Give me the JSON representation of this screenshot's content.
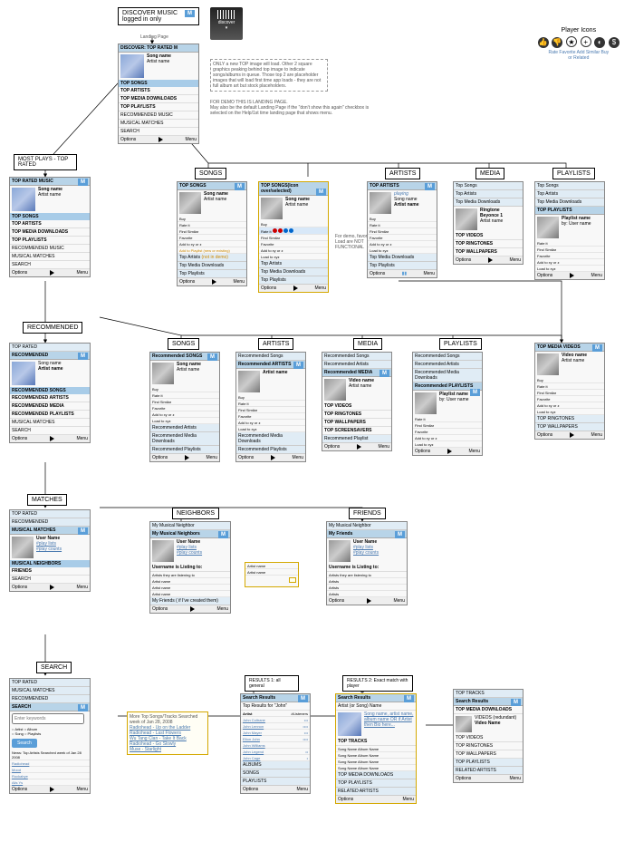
{
  "header": {
    "discover_music": "DISCOVER MUSIC",
    "logged_in": "logged in only",
    "landing_page": "Landing Page",
    "discover_btn": "discover"
  },
  "player_icons": {
    "title": "Player Icons",
    "labels": "Rate  Favorite  Add  Similar  Buy\nor Related"
  },
  "notes": {
    "top_note": "ONLY a new TOP image will load. Other 2 square graphics peaking behind top image to indicate songs/albums in queue. Those top 2 are placeholder images that will load first time app loads - they are not full album art but stock placeholders.",
    "demo_note": "FOR DEMO THIS IS LANDING PAGE.\nMay also be the default  Landing Page if the \"don't show this again\" checkbox is selected on the Help/1st time landing page that shows menu.",
    "functional": "For demo, favorite, Add, Load are NOT FUNCTIONAL",
    "not_in_demo": "(not in demo)",
    "more_searches": "More Top Songs/Tracks Searched week of Jan 28, 2008",
    "search_list": [
      "Radiohead - Up on the Ladder",
      "Radiohead - Last Flowers",
      "Wu Tang Clan - Take It Back",
      "Radiohead - Go Slowly",
      "Muse - Starlight"
    ]
  },
  "labels": {
    "most_plays": "MOST PLAYS - TOP RATED",
    "recommended": "RECOMMENDED",
    "matches": "MATCHES",
    "search": "SEARCH",
    "songs": "SONGS",
    "artists": "ARTISTS",
    "media": "MEDIA",
    "playlists": "PLAYLISTS",
    "neighbors": "NEIGHBORS",
    "friends": "FRIENDS",
    "results1": "RESULTS 1: all general",
    "results2": "RESULTS 2: Exact match with player"
  },
  "common": {
    "song_name": "Song name",
    "artist_name": "Artist name",
    "video_name": "Video name",
    "user_name": "User Name",
    "options": "Options",
    "menu": "Menu",
    "buy": "Buy",
    "rate_it": "Rate it",
    "find_similar": "Find Similar",
    "favorite": "Favorite",
    "add_xy_z": "Add to xy or z",
    "load_xyz": "Load to xyz",
    "add_playlist": "Add to Playlist (new or existing)",
    "playing": "playing",
    "play_lists": "#play lists",
    "play_counts": "#play counts",
    "listing_to": "Username is Listing to:",
    "artists_listening": "Artists they are listening to",
    "artists": "Artists",
    "by_user": "by: User name",
    "playlist_name": "Playlist name",
    "ringtone": "Ringtone",
    "beyonce": "Beyonce 1"
  },
  "panels": {
    "discover_top": {
      "title": "DISCOVER: TOP RATED M",
      "items": [
        "TOP SONGS",
        "TOP ARTISTS",
        "TOP MEDIA DOWNLOADS",
        "TOP PLAYLISTS"
      ],
      "items2": [
        "RECOMMENDED MUSIC",
        "MUSICAL MATCHES",
        "SEARCH"
      ]
    },
    "top_rated": {
      "title": "TOP RATED MUSIC",
      "items": [
        "TOP SONGS",
        "TOP ARTISTS",
        "TOP MEDIA DOWNLOADS",
        "TOP PLAYLISTS"
      ],
      "items2": [
        "RECOMMENDED MUSIC",
        "MUSICAL MATCHES",
        "SEARCH"
      ]
    },
    "top_songs": {
      "title": "TOP SONGS",
      "sel_title": "TOP SONGS(Icon over/selected)",
      "subs": [
        "Top Artists",
        "Top Media Downloads",
        "Top Playlists"
      ]
    },
    "top_artists": {
      "title": "TOP ARTISTS",
      "subs": [
        "Top Songs",
        "Top Media Downloads",
        "Top Playlists"
      ]
    },
    "media_hub": {
      "subs": [
        "Top Songs",
        "Top Artists",
        "Top Media Downloads"
      ],
      "items": [
        "TOP VIDEOS",
        "TOP RINGTONES",
        "TOP WALLPAPERS"
      ]
    },
    "playlists_hub": {
      "subs": [
        "Top Songs",
        "Top Artists",
        "Top Media Downloads"
      ],
      "title": "TOP PLAYLISTS"
    },
    "recommended": {
      "hdr": "TOP RATED",
      "title": "RECOMMENDED",
      "items": [
        "RECOMMENDED SONGS",
        "RECOMMENDED ARTISTS",
        "RECOMMENDED MEDIA",
        "RECOMMENDED PLAYLISTS"
      ],
      "items2": [
        "MUSICAL MATCHES",
        "SEARCH"
      ]
    },
    "rec_songs": {
      "title": "Recommended SONGS",
      "subs": [
        "Recommended Artists",
        "Recommended Media Downloads",
        "Recommended Playlists"
      ]
    },
    "rec_artists": {
      "title": "Recommended ARTISTS",
      "hdr": "Recommended Songs",
      "subs": [
        "Recommended Media Downloads",
        "Recommended Playlists"
      ]
    },
    "rec_media": {
      "title": "Recommended MEDIA",
      "hdrs": [
        "Recommended Songs",
        "Recommended Artists"
      ],
      "items": [
        "TOP VIDEOS",
        "TOP RINGTONES",
        "TOP WALLPAPERS",
        "TOP SCREENSAVERS"
      ],
      "sub": "Recommened Playlist"
    },
    "rec_playlists": {
      "title": "Recommended PLAYLISTS",
      "hdrs": [
        "Recommended Songs",
        "Recommended Artists",
        "Recommended Media Downloads"
      ]
    },
    "top_media_videos": {
      "title": "TOP MEDIA VIDEOS",
      "subs": [
        "TOP RINGTONES",
        "TOP WALLPAPERS"
      ]
    },
    "matches": {
      "hdrs": [
        "TOP RATED",
        "RECOMMENDED"
      ],
      "title": "MUSICAL MATCHES",
      "items": [
        "MUSICAL NEIGHBORS",
        "FRIENDS"
      ],
      "items2": [
        "SEARCH"
      ]
    },
    "neighbors": {
      "title": "My Musical Neighbors",
      "hdr": "My Musical Neighbor",
      "foot": "My Friends ( if I've created them)"
    },
    "friends": {
      "title": "My Friends",
      "hdr": "My Musical Neighbor"
    },
    "search_panel": {
      "hdrs": [
        "TOP RATED",
        "MUSICAL MATCHES",
        "RECOMMENDED"
      ],
      "title": "SEARCH",
      "placeholder": "Enter keywords",
      "opts": [
        "Artist",
        "Song",
        "Album",
        "Playlists"
      ],
      "btn": "Search",
      "news": "News: Top Artists Searched week of Jan 28 2008",
      "news_items": [
        "Radiohead",
        "Mood",
        "Rockabye",
        "Alis Ys"
      ]
    },
    "results1": {
      "title": "Search Results",
      "sub": "Top Results for \"John\"",
      "cols": [
        "Artist",
        "#Listeners"
      ],
      "rows": [
        "John Coltrane",
        "John Lennon",
        "John Mayer",
        "Elton John",
        "John Williams",
        "John Legend",
        "John Cage"
      ],
      "subs": [
        "ALBUMS",
        "SONGS",
        "PLAYLISTS"
      ]
    },
    "results2": {
      "title": "Search Results",
      "sub": "Artist (or Song) Name",
      "desc": "Song name, artist name, album name OR if Artist then Bio here...",
      "sec": "TOP TRACKS",
      "rows": [
        "Song Name   Album Name",
        "Song Name   Album Name",
        "Song Name   Album Name",
        "Song Name   Album Name"
      ],
      "subs": [
        "TOP MEDIA DOWNLOADS",
        "TOP PLAYLISTS",
        "RELATED ARTISTS"
      ]
    },
    "results_side": {
      "hdr": "TOP TRACKS",
      "title": "Search Results",
      "sub": "TOP MEDIA DOWNLOADS",
      "item": "VIDEOS (redundant)",
      "item2": "Video Name",
      "subs": [
        "TOP VIDEOS",
        "TOP RINGTONES",
        "TOP WALLPAPERS"
      ],
      "subs2": [
        "TOP PLAYLISTS",
        "RELATED ARTISTS"
      ]
    },
    "neighbor_popup": [
      "Artist name",
      "Artist name"
    ]
  }
}
